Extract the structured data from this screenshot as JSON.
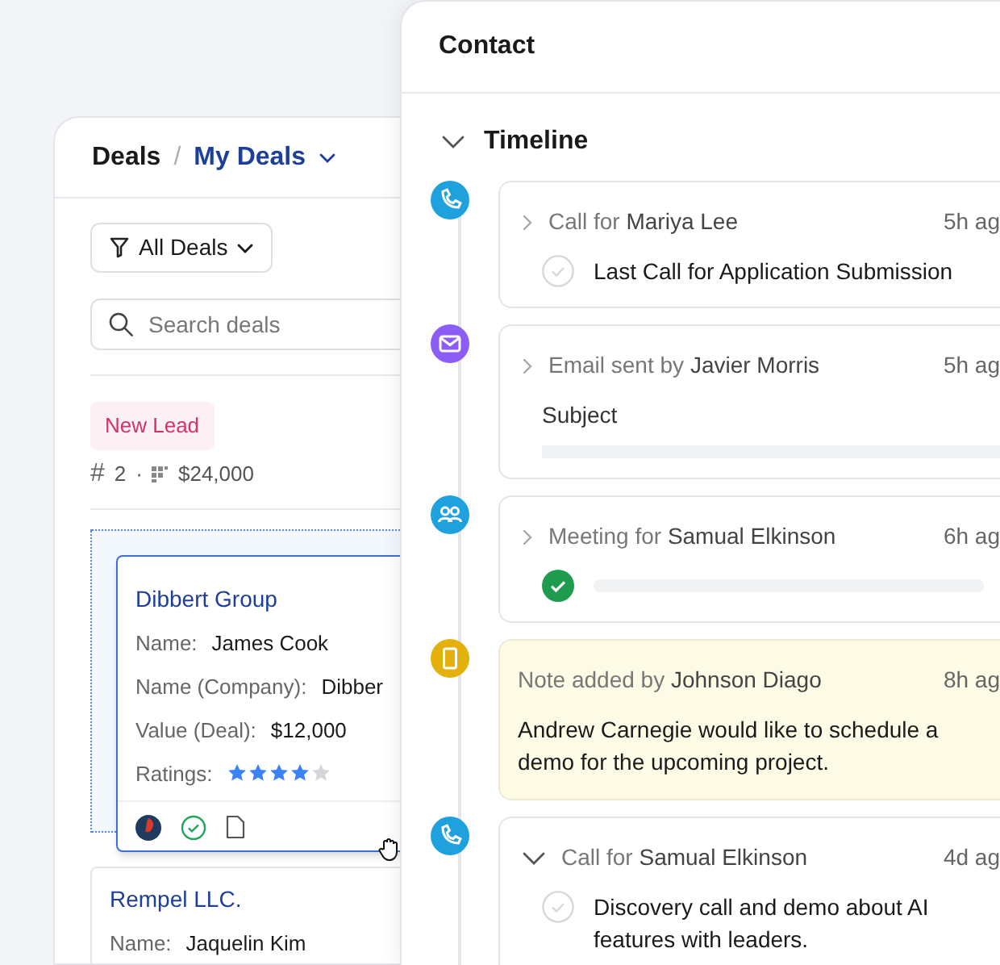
{
  "deals_panel": {
    "breadcrumb": {
      "root": "Deals",
      "separator": "/",
      "current": "My Deals"
    },
    "filter": {
      "label": "All Deals"
    },
    "search": {
      "placeholder": "Search deals"
    },
    "stage": {
      "label": "New Lead",
      "count_symbol": "#",
      "count": "2",
      "separator": "·",
      "total": "$24,000"
    },
    "cards": [
      {
        "title": "Dibbert Group",
        "dragging": true,
        "fields": [
          {
            "label": "Name:",
            "value": "James Cook"
          },
          {
            "label": "Name (Company):",
            "value": "Dibber"
          },
          {
            "label": "Value (Deal):",
            "value": "$12,000"
          }
        ],
        "rating": {
          "label": "Ratings:",
          "stars": 4
        },
        "footer": true
      },
      {
        "title": "Rempel LLC.",
        "dragging": false,
        "fields": [
          {
            "label": "Name:",
            "value": "Jaquelin Kim"
          }
        ]
      }
    ]
  },
  "contact_panel": {
    "title": "Contact",
    "section": {
      "label": "Timeline",
      "expanded": true
    },
    "events": [
      {
        "kind": "call",
        "title": "Call for **Mariya Lee**",
        "time": "5h ag",
        "expanded": false,
        "task": {
          "text": "Last Call for Application Submission",
          "done": false
        }
      },
      {
        "kind": "email",
        "title": "Email sent by **Javier Morris**",
        "time": "5h ag",
        "expanded": false,
        "subject_label": "Subject"
      },
      {
        "kind": "meeting",
        "title": "Meeting for **Samual Elkinson**",
        "time": "6h ag",
        "expanded": false,
        "task": {
          "done": true
        }
      },
      {
        "kind": "note",
        "title": "Note added by **Johnson Diago**",
        "time": "8h ag",
        "body": "Andrew Carnegie would like to schedule a demo for the upcoming project."
      },
      {
        "kind": "call",
        "title": "Call for **Samual Elkinson**",
        "time": "4d ag",
        "expanded": true,
        "task": {
          "text": "Discovery call and demo about AI features with leaders.",
          "done": false
        }
      }
    ]
  }
}
